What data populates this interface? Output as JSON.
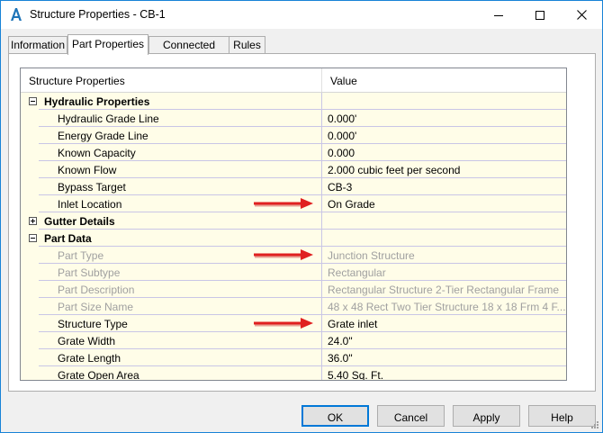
{
  "window": {
    "title": "Structure Properties - CB-1"
  },
  "tabs": [
    {
      "label": "Information",
      "active": false
    },
    {
      "label": "Part Properties",
      "active": true
    },
    {
      "label": "Connected Pipes",
      "active": false
    },
    {
      "label": "Rules",
      "active": false
    }
  ],
  "grid": {
    "headers": {
      "name": "Structure Properties",
      "value": "Value"
    },
    "rows": [
      {
        "type": "category",
        "expanded": true,
        "name": "Hydraulic Properties",
        "value": ""
      },
      {
        "type": "property",
        "name": "Hydraulic Grade Line",
        "value": "0.000'"
      },
      {
        "type": "property",
        "name": "Energy Grade Line",
        "value": "0.000'"
      },
      {
        "type": "property",
        "name": "Known Capacity",
        "value": "0.000"
      },
      {
        "type": "property",
        "name": "Known Flow",
        "value": "2.000 cubic feet per second"
      },
      {
        "type": "property",
        "name": "Bypass Target",
        "value": "CB-3"
      },
      {
        "type": "property",
        "name": "Inlet Location",
        "value": "On Grade",
        "highlighted": true
      },
      {
        "type": "category",
        "expanded": false,
        "name": "Gutter Details",
        "value": ""
      },
      {
        "type": "category",
        "expanded": true,
        "name": "Part Data",
        "value": ""
      },
      {
        "type": "property",
        "readonly": true,
        "name": "Part Type",
        "value": "Junction Structure",
        "highlighted": true
      },
      {
        "type": "property",
        "readonly": true,
        "name": "Part Subtype",
        "value": "Rectangular"
      },
      {
        "type": "property",
        "readonly": true,
        "name": "Part Description",
        "value": "Rectangular Structure 2-Tier Rectangular Frame"
      },
      {
        "type": "property",
        "readonly": true,
        "name": "Part Size Name",
        "value": "48 x 48 Rect Two Tier Structure 18 x 18 Frm 4 F..."
      },
      {
        "type": "property",
        "name": "Structure Type",
        "value": "Grate inlet",
        "highlighted": true
      },
      {
        "type": "property",
        "name": "Grate Width",
        "value": "24.0\""
      },
      {
        "type": "property",
        "name": "Grate Length",
        "value": "36.0\""
      },
      {
        "type": "property",
        "name": "Grate Open Area",
        "value": "5.40 Sq. Ft."
      }
    ]
  },
  "buttons": {
    "ok": "OK",
    "cancel": "Cancel",
    "apply": "Apply",
    "help": "Help"
  },
  "colors": {
    "accent": "#0078d7",
    "row_bg": "#fffde8",
    "annotation_arrow": "#e02020"
  }
}
